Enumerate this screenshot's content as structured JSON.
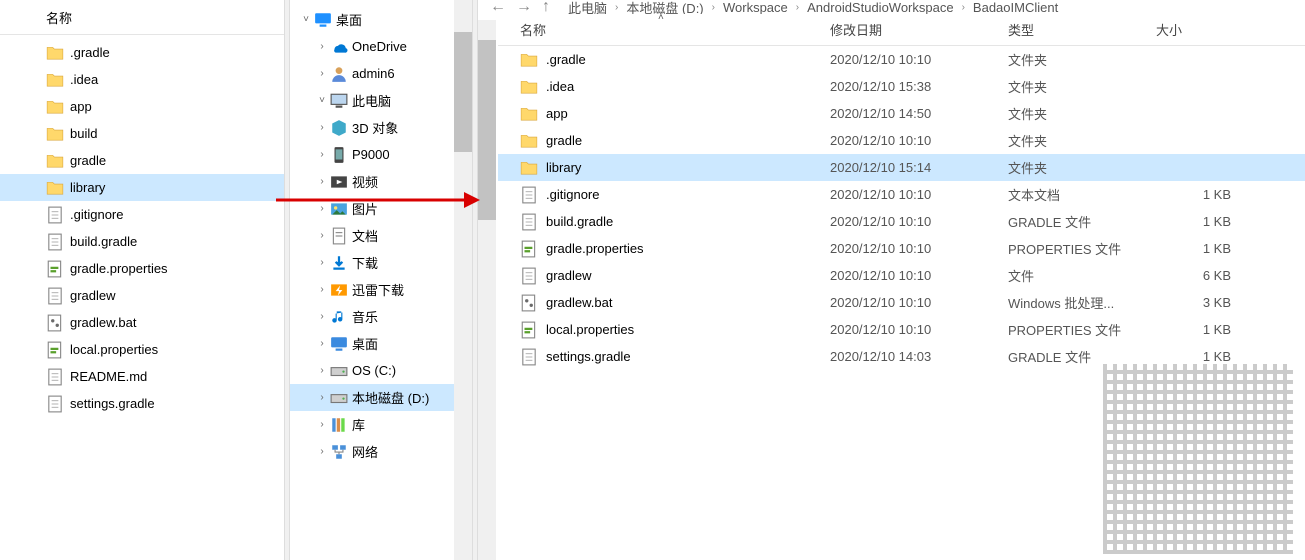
{
  "left": {
    "header": "名称",
    "items": [
      {
        "name": ".gradle",
        "type": "folder"
      },
      {
        "name": ".idea",
        "type": "folder"
      },
      {
        "name": "app",
        "type": "folder"
      },
      {
        "name": "build",
        "type": "folder"
      },
      {
        "name": "gradle",
        "type": "folder"
      },
      {
        "name": "library",
        "type": "folder",
        "selected": true
      },
      {
        "name": ".gitignore",
        "type": "file-text"
      },
      {
        "name": "build.gradle",
        "type": "file-text"
      },
      {
        "name": "gradle.properties",
        "type": "file-prop"
      },
      {
        "name": "gradlew",
        "type": "file-text"
      },
      {
        "name": "gradlew.bat",
        "type": "file-bat"
      },
      {
        "name": "local.properties",
        "type": "file-prop"
      },
      {
        "name": "README.md",
        "type": "file-text"
      },
      {
        "name": "settings.gradle",
        "type": "file-text"
      }
    ]
  },
  "tree": [
    {
      "name": "桌面",
      "icon": "desktop",
      "chev": "v",
      "indent": 1
    },
    {
      "name": "OneDrive",
      "icon": "onedrive",
      "chev": ">",
      "indent": 2
    },
    {
      "name": "admin6",
      "icon": "user",
      "chev": ">",
      "indent": 2
    },
    {
      "name": "此电脑",
      "icon": "pc",
      "chev": "v",
      "indent": 2
    },
    {
      "name": "3D 对象",
      "icon": "3d",
      "chev": ">",
      "indent": 2
    },
    {
      "name": "P9000",
      "icon": "phone",
      "chev": ">",
      "indent": 2
    },
    {
      "name": "视频",
      "icon": "video",
      "chev": ">",
      "indent": 2
    },
    {
      "name": "图片",
      "icon": "pictures",
      "chev": ">",
      "indent": 2
    },
    {
      "name": "文档",
      "icon": "documents",
      "chev": ">",
      "indent": 2
    },
    {
      "name": "下载",
      "icon": "downloads",
      "chev": ">",
      "indent": 2
    },
    {
      "name": "迅雷下载",
      "icon": "xunlei",
      "chev": ">",
      "indent": 2
    },
    {
      "name": "音乐",
      "icon": "music",
      "chev": ">",
      "indent": 2
    },
    {
      "name": "桌面",
      "icon": "desktop2",
      "chev": ">",
      "indent": 2
    },
    {
      "name": "OS (C:)",
      "icon": "drive",
      "chev": ">",
      "indent": 2
    },
    {
      "name": "本地磁盘 (D:)",
      "icon": "drive",
      "chev": ">",
      "indent": 2,
      "selected": true
    },
    {
      "name": "库",
      "icon": "libraries",
      "chev": ">",
      "indent": 2
    },
    {
      "name": "网络",
      "icon": "network",
      "chev": ">",
      "indent": 2
    }
  ],
  "breadcrumb": [
    "此电脑",
    "本地磁盘 (D:)",
    "Workspace",
    "AndroidStudioWorkspace",
    "BadaoIMClient"
  ],
  "columns": {
    "name": "名称",
    "date": "修改日期",
    "type": "类型",
    "size": "大小"
  },
  "files": [
    {
      "name": ".gradle",
      "date": "2020/12/10 10:10",
      "type": "文件夹",
      "size": "",
      "icon": "folder"
    },
    {
      "name": ".idea",
      "date": "2020/12/10 15:38",
      "type": "文件夹",
      "size": "",
      "icon": "folder"
    },
    {
      "name": "app",
      "date": "2020/12/10 14:50",
      "type": "文件夹",
      "size": "",
      "icon": "folder"
    },
    {
      "name": "gradle",
      "date": "2020/12/10 10:10",
      "type": "文件夹",
      "size": "",
      "icon": "folder"
    },
    {
      "name": "library",
      "date": "2020/12/10 15:14",
      "type": "文件夹",
      "size": "",
      "icon": "folder",
      "selected": true
    },
    {
      "name": ".gitignore",
      "date": "2020/12/10 10:10",
      "type": "文本文档",
      "size": "1 KB",
      "icon": "file-text"
    },
    {
      "name": "build.gradle",
      "date": "2020/12/10 10:10",
      "type": "GRADLE 文件",
      "size": "1 KB",
      "icon": "file-text"
    },
    {
      "name": "gradle.properties",
      "date": "2020/12/10 10:10",
      "type": "PROPERTIES 文件",
      "size": "1 KB",
      "icon": "file-prop"
    },
    {
      "name": "gradlew",
      "date": "2020/12/10 10:10",
      "type": "文件",
      "size": "6 KB",
      "icon": "file-text"
    },
    {
      "name": "gradlew.bat",
      "date": "2020/12/10 10:10",
      "type": "Windows 批处理...",
      "size": "3 KB",
      "icon": "file-bat"
    },
    {
      "name": "local.properties",
      "date": "2020/12/10 10:10",
      "type": "PROPERTIES 文件",
      "size": "1 KB",
      "icon": "file-prop"
    },
    {
      "name": "settings.gradle",
      "date": "2020/12/10 14:03",
      "type": "GRADLE 文件",
      "size": "1 KB",
      "icon": "file-text"
    }
  ],
  "icon_colors": {
    "folder": "#ffd86b",
    "onedrive": "#0078d4",
    "desktop": "#1e90ff",
    "pc": "#3a3a3a",
    "drive": "#808080",
    "downloads": "#0078d4",
    "music": "#0078d4",
    "xunlei": "#ff9900"
  }
}
